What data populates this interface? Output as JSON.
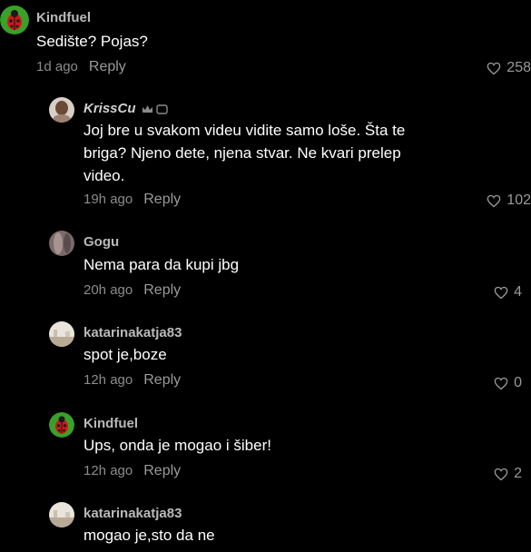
{
  "comments": [
    {
      "author": "Kindfuel",
      "text": "Sedište? Pojas?",
      "time": "1d ago",
      "reply_label": "Reply",
      "likes": "258",
      "avatar_icon": "ladybug-avatar-icon"
    },
    {
      "author": "KrissCu",
      "text": "Joj bre u svakom videu vidite samo loše. Šta te\nbriga? Njeno dete, njena stvar. Ne kvari prelep\nvideo.",
      "time": "19h ago",
      "reply_label": "Reply",
      "likes": "102",
      "avatar_icon": "user-photo-avatar-icon"
    },
    {
      "author": "Gogu",
      "text": "Nema para da kupi jbg",
      "time": "20h ago",
      "reply_label": "Reply",
      "likes": "4",
      "avatar_icon": "user-photo-avatar-icon"
    },
    {
      "author": "katarinakatja83",
      "text": "spot je,boze",
      "time": "12h ago",
      "reply_label": "Reply",
      "likes": "0",
      "avatar_icon": "landscape-avatar-icon"
    },
    {
      "author": "Kindfuel",
      "text": "Ups, onda je mogao i šiber!",
      "time": "12h ago",
      "reply_label": "Reply",
      "likes": "2",
      "avatar_icon": "ladybug-avatar-icon"
    },
    {
      "author": "katarinakatja83",
      "text": "mogao je,sto da ne",
      "avatar_icon": "landscape-avatar-icon"
    }
  ],
  "colors": {
    "background": "#000000",
    "text": "#ffffff",
    "muted": "#8c8c8c",
    "ladybug_bg": "#3aa02a",
    "ladybug_red": "#d01818"
  }
}
